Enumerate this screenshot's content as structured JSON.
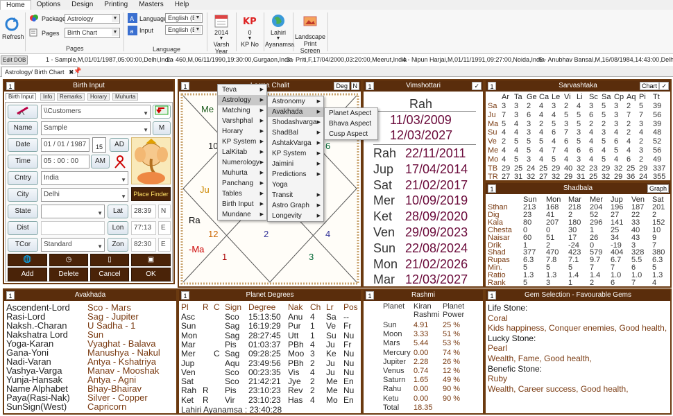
{
  "menubar": {
    "home": "Home",
    "options": "Options",
    "design": "Design",
    "printing": "Printing",
    "masters": "Masters",
    "help": "Help"
  },
  "ribbon": {
    "refresh": "Refresh",
    "package_label": "Package",
    "package_value": "Astrology",
    "pages_label": "Pages",
    "pages_value": "Birth Chart",
    "pages_group": "Pages",
    "language_label": "Language",
    "language_value": "English (E",
    "input_label": "Input",
    "input_value": "English (E",
    "language_group": "Language",
    "varsh_year_value": "2014",
    "varsh_year_label": "Varsh Year",
    "kp_no_value": "0",
    "kp_no_label": "KP No",
    "ayanamsa_value": "Lahiri",
    "ayanamsa_label": "Ayanamsa",
    "landscape_label": "Landscape",
    "print_screen_label": "Print Screen"
  },
  "recent": {
    "edit": "Edit DOB",
    "items": [
      "1 - Sample,M,01/01/1987,05:00:00,Delhi,India",
      "2 - 460,M,06/11/1990,19:30:00,Gurgaon,India",
      "3 - Priti,F,17/04/2000,03:20:00,Meerut,India",
      "4 - Nipun Harjai,M,01/11/1991,09:27:00,Noida,India",
      "5 - Anubhav Bansal,M,16/08/1984,14:43:00,Delhi,India"
    ]
  },
  "doc_tab": "Astrology/ Birth Chart",
  "birth_input": {
    "num": "1",
    "title": "Birth Input",
    "tabs": [
      "Birth Input",
      "Info",
      "Remarks",
      "Horary",
      "Muhurta"
    ],
    "folder": "\\\\Customers",
    "name_label": "Name",
    "name": "Sample",
    "m_btn": "M",
    "date_label": "Date",
    "date": "01 / 01 / 1987",
    "cal": "15",
    "ad": "AD",
    "time_label": "Time",
    "time": "05 : 00 : 00",
    "am": "AM",
    "cntry_label": "Cntry",
    "country": "India",
    "city_label": "City",
    "city": "Delhi",
    "place_finder": "Place Finder",
    "state_label": "State",
    "lat_label": "Lat",
    "lat": "28:39",
    "lat_dir": "N",
    "dist_label": "Dist",
    "lon_label": "Lon",
    "lon": "77:13",
    "lon_dir": "E",
    "tcor_label": "TCor",
    "tcor": "Standard",
    "zon_label": "Zon",
    "zon": "82:30",
    "zon_dir": "E",
    "add": "Add",
    "delete": "Delete",
    "cancel": "Cancel",
    "ok": "OK"
  },
  "lagna": {
    "num": "1",
    "title": "Lagna Chalit",
    "deg": "Deg",
    "n": "N",
    "labels": [
      "Me",
      "10",
      "Ju",
      "Ra",
      "-Ma",
      "12",
      "2",
      "6",
      "4",
      "1",
      "3"
    ]
  },
  "vimshottari": {
    "num": "1",
    "title": "Vimshottari",
    "maha": "Rah",
    "start": "11/03/2009",
    "end": "12/03/2027",
    "rows": [
      [
        "Rah",
        "22/11/2011"
      ],
      [
        "Jup",
        "17/04/2014"
      ],
      [
        "Sat",
        "21/02/2017"
      ],
      [
        "Mer",
        "10/09/2019"
      ],
      [
        "Ket",
        "28/09/2020"
      ],
      [
        "Ven",
        "29/09/2023"
      ],
      [
        "Sun",
        "22/08/2024"
      ],
      [
        "Mon",
        "21/02/2026"
      ],
      [
        "Mar",
        "12/03/2027"
      ]
    ]
  },
  "sarvashtaka": {
    "num": "1",
    "title": "Sarvashtaka",
    "chart_btn": "Chart",
    "header": [
      "",
      "Ar",
      "Ta",
      "Ge",
      "Ca",
      "Le",
      "Vi",
      "Li",
      "Sc",
      "Sa",
      "Cp",
      "Aq",
      "Pi",
      "Tt"
    ],
    "rows": [
      [
        "Sa",
        "3",
        "3",
        "2",
        "4",
        "3",
        "2",
        "4",
        "3",
        "5",
        "3",
        "2",
        "5",
        "39"
      ],
      [
        "Ju",
        "7",
        "3",
        "6",
        "4",
        "4",
        "5",
        "5",
        "6",
        "5",
        "3",
        "7",
        "7",
        "56"
      ],
      [
        "Ma",
        "5",
        "4",
        "3",
        "2",
        "5",
        "3",
        "5",
        "2",
        "2",
        "3",
        "2",
        "3",
        "39"
      ],
      [
        "Su",
        "4",
        "4",
        "3",
        "4",
        "6",
        "7",
        "3",
        "4",
        "3",
        "4",
        "2",
        "4",
        "48"
      ],
      [
        "Ve",
        "2",
        "5",
        "5",
        "5",
        "4",
        "6",
        "5",
        "4",
        "5",
        "6",
        "4",
        "2",
        "52"
      ],
      [
        "Me",
        "4",
        "4",
        "5",
        "4",
        "7",
        "4",
        "6",
        "6",
        "4",
        "5",
        "4",
        "3",
        "56"
      ],
      [
        "Mo",
        "4",
        "5",
        "3",
        "4",
        "5",
        "4",
        "3",
        "4",
        "5",
        "4",
        "6",
        "2",
        "49"
      ],
      [
        "TB",
        "29",
        "25",
        "24",
        "25",
        "29",
        "40",
        "32",
        "23",
        "29",
        "32",
        "25",
        "29",
        "337"
      ],
      [
        "TR",
        "27",
        "31",
        "32",
        "27",
        "32",
        "29",
        "31",
        "25",
        "32",
        "29",
        "36",
        "24",
        "355"
      ]
    ]
  },
  "shadbala": {
    "num": "1",
    "title": "Shadbala",
    "graph_btn": "Graph",
    "header": [
      "",
      "Sun",
      "Mon",
      "Mar",
      "Mer",
      "Jup",
      "Ven",
      "Sat"
    ],
    "rows": [
      [
        "Sthan",
        "213",
        "168",
        "218",
        "204",
        "196",
        "187",
        "201"
      ],
      [
        "Dig",
        "23",
        "41",
        "2",
        "52",
        "27",
        "22",
        "2"
      ],
      [
        "Kala",
        "80",
        "207",
        "180",
        "296",
        "141",
        "33",
        "152"
      ],
      [
        "Chesta",
        "0",
        "0",
        "30",
        "1",
        "25",
        "40",
        "10"
      ],
      [
        "Naisar",
        "60",
        "51",
        "17",
        "26",
        "34",
        "43",
        "9"
      ],
      [
        "Drik",
        "1",
        "2",
        "-24",
        "0",
        "-19",
        "3",
        "7"
      ],
      [
        "Shad",
        "377",
        "470",
        "423",
        "579",
        "404",
        "328",
        "380"
      ],
      [
        "Rupas",
        "6.3",
        "7.8",
        "7.1",
        "9.7",
        "6.7",
        "5.5",
        "6.3"
      ],
      [
        "Min.",
        "5",
        "5",
        "5",
        "7",
        "7",
        "6",
        "5"
      ],
      [
        "Ratio",
        "1.3",
        "1.3",
        "1.4",
        "1.4",
        "1.0",
        "1.0",
        "1.3"
      ],
      [
        "Rank",
        "5",
        "3",
        "1",
        "2",
        "6",
        "7",
        "4"
      ]
    ]
  },
  "avakhada": {
    "num": "1",
    "title": "Avakhada",
    "rows": [
      [
        "Ascendent-Lord",
        "Sco - Mars"
      ],
      [
        "Rasi-Lord",
        "Sag - Jupiter"
      ],
      [
        "Naksh.-Charan",
        "U Sadha - 1"
      ],
      [
        "Nakshatra Lord",
        "Sun"
      ],
      [
        "Yoga-Karan",
        "Vyaghat - Balava"
      ],
      [
        "Gana-Yoni",
        "Manushya - Nakul"
      ],
      [
        "Nadi-Varan",
        "Antya - Kshatriya"
      ],
      [
        "Vashya-Varga",
        "Manav - Mooshak"
      ],
      [
        "Yunja-Hansak",
        "Antya - Agni"
      ],
      [
        "Name Alphabet",
        "Bhay-Bhairav"
      ],
      [
        "Paya(Rasi-Nak)",
        "Silver - Copper"
      ],
      [
        "SunSign(West)",
        "Capricorn"
      ]
    ]
  },
  "planet_degrees": {
    "num": "1",
    "title": "Planet Degrees",
    "header": [
      "Pl",
      "R",
      "C",
      "Sign",
      "Degree",
      "Nak",
      "Ch",
      "Lr",
      "Pos"
    ],
    "rows": [
      [
        "Asc",
        "",
        "",
        "Sco",
        "15:13:50",
        "Anu",
        "4",
        "Sa",
        "--"
      ],
      [
        "Sun",
        "",
        "",
        "Sag",
        "16:19:29",
        "Pur",
        "1",
        "Ve",
        "Fr"
      ],
      [
        "Mon",
        "",
        "",
        "Sag",
        "28:27:45",
        "Utt",
        "1",
        "Su",
        "Nu"
      ],
      [
        "Mar",
        "",
        "",
        "Pis",
        "01:03:37",
        "PBh",
        "4",
        "Ju",
        "Fr"
      ],
      [
        "Mer",
        "",
        "C",
        "Sag",
        "09:28:25",
        "Moo",
        "3",
        "Ke",
        "Nu"
      ],
      [
        "Jup",
        "",
        "",
        "Aqu",
        "23:49:56",
        "PBh",
        "2",
        "Ju",
        "Nu"
      ],
      [
        "Ven",
        "",
        "",
        "Sco",
        "00:23:35",
        "Vis",
        "4",
        "Ju",
        "Nu"
      ],
      [
        "Sat",
        "",
        "",
        "Sco",
        "21:42:21",
        "Jye",
        "2",
        "Me",
        "En"
      ],
      [
        "Rah",
        "R",
        "",
        "Pis",
        "23:10:23",
        "Rev",
        "2",
        "Me",
        "Nu"
      ],
      [
        "Ket",
        "R",
        "",
        "Vir",
        "23:10:23",
        "Has",
        "4",
        "Mo",
        "En"
      ]
    ],
    "ayanamsa": "Lahiri Ayanamsa : 23:40:28"
  },
  "rashmi": {
    "num": "1",
    "title": "Rashmi",
    "header": [
      "Planet",
      "Kiran\nRashmi",
      "Planet\nPower"
    ],
    "h1": [
      "Planet",
      "Kiran",
      "Planet"
    ],
    "h2": [
      "",
      "Rashmi",
      "Power"
    ],
    "rows": [
      [
        "Sun",
        "4.91",
        "25 %"
      ],
      [
        "Moon",
        "3.33",
        "51 %"
      ],
      [
        "Mars",
        "5.44",
        "53 %"
      ],
      [
        "Mercury",
        "0.00",
        "74 %"
      ],
      [
        "Jupiter",
        "2.28",
        "26 %"
      ],
      [
        "Venus",
        "0.74",
        "12 %"
      ],
      [
        "Saturn",
        "1.65",
        "49 %"
      ],
      [
        "Rahu",
        "0.00",
        "90 %"
      ],
      [
        "Ketu",
        "0.00",
        "90 %"
      ],
      [
        "Total",
        "18.35",
        ""
      ]
    ]
  },
  "gems": {
    "num": "1",
    "title": "Gem Selection - Favourable Gems",
    "lines": [
      "Life Stone:",
      "Coral",
      "Kids happiness, Conquer enemies, Good health,",
      "Lucky Stone:",
      "Pearl",
      "Wealth, Fame, Good health,",
      "Benefic Stone:",
      "Ruby",
      "Wealth, Career success, Good health,"
    ]
  },
  "menu1": [
    "Teva",
    "Astrology",
    "Matching",
    "Varshphal",
    "Horary",
    "KP System",
    "LalKitab",
    "Numerology",
    "Muhurta",
    "Panchang",
    "Tables",
    "Birth Input",
    "Mundane"
  ],
  "menu2": [
    "Astronomy",
    "Avakhada",
    "Shodashvarga",
    "ShadBal",
    "AshtakVarga",
    "KP System",
    "Jaimini",
    "Predictions",
    "Yoga",
    "Transit",
    "Astro Graph",
    "Longevity"
  ],
  "menu3": [
    "Planet Aspect",
    "Bhava Aspect",
    "Cusp Aspect"
  ],
  "colors": {
    "panel_header": "#5a2d0c",
    "accent_text": "#7a3b12",
    "dark_button": "#4a2308"
  }
}
